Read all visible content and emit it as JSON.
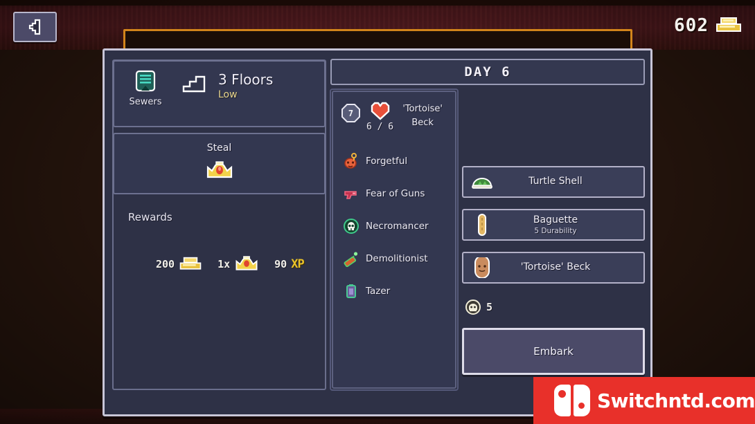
{
  "topbar": {
    "back_button_icon": "back-arrow-icon",
    "currency_amount": "602",
    "currency_icon": "gold-bars-icon"
  },
  "header": {
    "day_label": "DAY 6"
  },
  "mission": {
    "location_name": "Sewers",
    "location_icon": "sewers-icon",
    "floors_icon": "stairs-icon",
    "floors_label": "3 Floors",
    "danger_label": "Low",
    "objective_label": "Steal",
    "objective_icon": "crown-icon"
  },
  "rewards": {
    "title": "Rewards",
    "entries": [
      {
        "amount": "200",
        "icon": "gold-bars-icon",
        "name": "gold"
      },
      {
        "amount": "1x",
        "icon": "crown-icon",
        "name": "crown"
      },
      {
        "amount": "90",
        "icon": "xp-icon",
        "name": "xp",
        "suffix": "XP"
      }
    ]
  },
  "hero": {
    "level": "7",
    "health": "6 / 6",
    "health_icon": "heart-icon",
    "name_line1": "'Tortoise'",
    "name_line2": "Beck",
    "traits": [
      {
        "label": "Forgetful",
        "icon": "forgetful-icon",
        "color": "#e8633c"
      },
      {
        "label": "Fear of Guns",
        "icon": "gun-icon",
        "color": "#e03a5e"
      },
      {
        "label": "Necromancer",
        "icon": "skull-icon",
        "color": "#3fc98a"
      },
      {
        "label": "Demolitionist",
        "icon": "dynamite-icon",
        "color": "#56d46a"
      },
      {
        "label": "Tazer",
        "icon": "tazer-icon",
        "color": "#49c993"
      }
    ]
  },
  "loadout": {
    "items": [
      {
        "name": "Turtle Shell",
        "sub": "",
        "icon": "turtle-shell-icon"
      },
      {
        "name": "Baguette",
        "sub": "5 Durability",
        "icon": "baguette-icon"
      },
      {
        "name": "'Tortoise' Beck",
        "sub": "",
        "icon": "hero-portrait-icon"
      }
    ],
    "supply_amount": "5",
    "supply_icon": "food-icon",
    "embark_label": "Embark"
  },
  "watermark": {
    "text": "Switchntd.com",
    "logo_icon": "nintendo-switch-icon",
    "color": "#e8302a"
  },
  "colors": {
    "background": "#26150d",
    "panel": "#333750",
    "dialog": "#2e3146",
    "border_light": "#c8c6d8",
    "accent_orange": "#d2841b",
    "gold_text": "#e9c32a"
  }
}
